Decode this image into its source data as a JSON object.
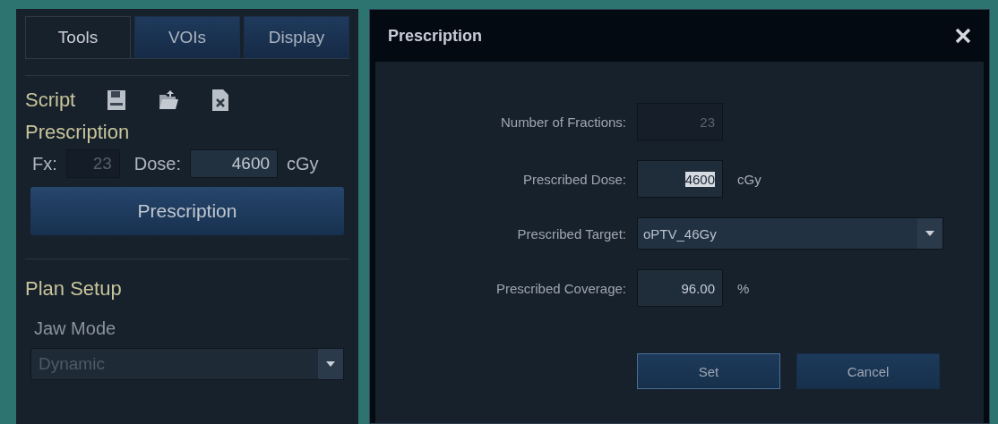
{
  "side_panel": {
    "tabs": [
      {
        "label": "Tools",
        "selected": true
      },
      {
        "label": "VOIs",
        "selected": false
      },
      {
        "label": "Display",
        "selected": false
      }
    ],
    "script": {
      "label": "Script"
    },
    "prescription": {
      "heading": "Prescription",
      "fx_label": "Fx:",
      "fx_value": "23",
      "fx_disabled": true,
      "dose_label": "Dose:",
      "dose_value": "4600",
      "dose_disabled": false,
      "dose_unit": "cGy",
      "button": "Prescription"
    },
    "plan_setup": {
      "heading": "Plan Setup",
      "jaw_mode_label": "Jaw Mode",
      "jaw_mode_value": "Dynamic",
      "jaw_mode_disabled": true
    }
  },
  "dialog": {
    "title": "Prescription",
    "fields": [
      {
        "kind": "number",
        "label": "Number of Fractions:",
        "value": "23",
        "disabled": true,
        "selected": false
      },
      {
        "kind": "number",
        "label": "Prescribed Dose:",
        "value": "4600",
        "unit": "cGy",
        "disabled": false,
        "selected": true
      },
      {
        "kind": "select",
        "label": "Prescribed Target:",
        "value": "oPTV_46Gy",
        "disabled": false,
        "selected": false
      },
      {
        "kind": "number",
        "label": "Prescribed Coverage:",
        "value": "96.00",
        "unit": "%",
        "disabled": false,
        "selected": false
      }
    ],
    "buttons": [
      {
        "label": "Set",
        "focused": true
      },
      {
        "label": "Cancel",
        "focused": false
      }
    ]
  }
}
